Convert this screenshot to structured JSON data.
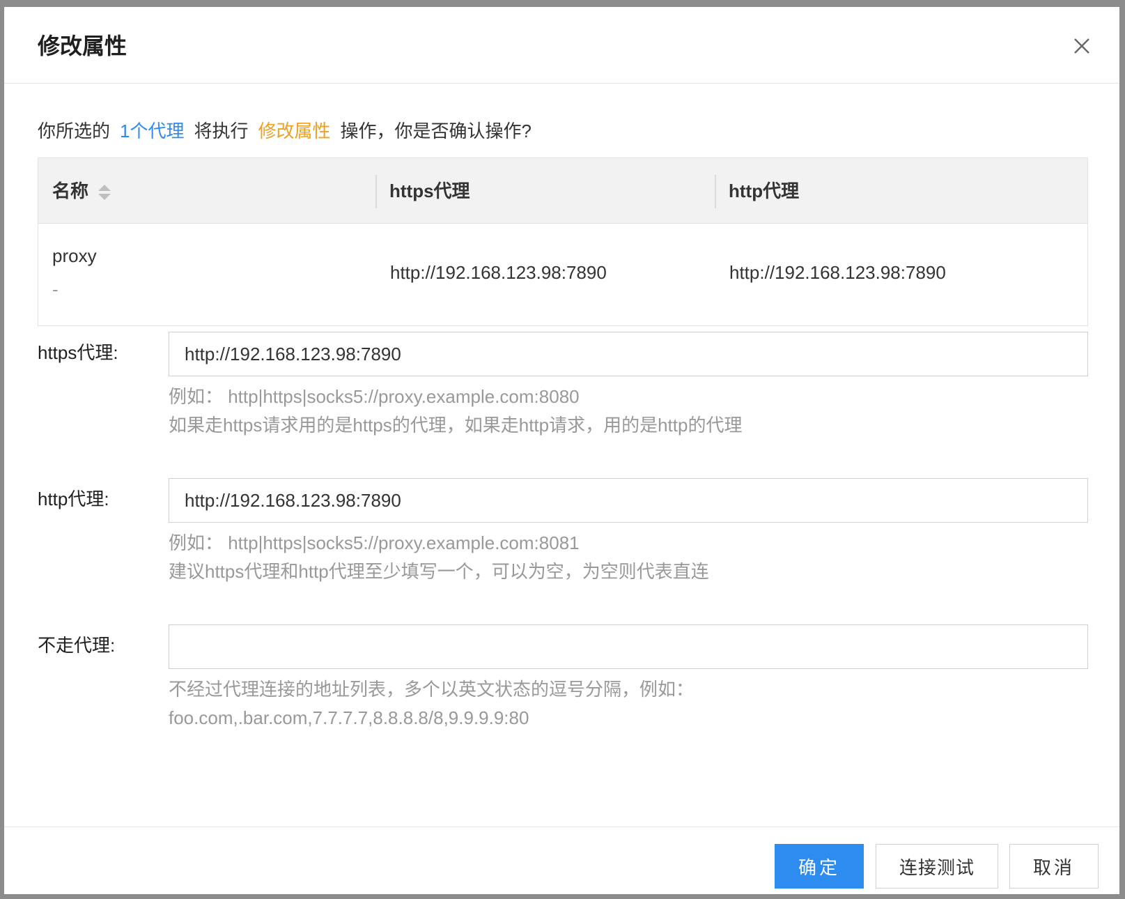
{
  "dialog": {
    "title": "修改属性"
  },
  "confirm": {
    "prefix": "你所选的",
    "count": "1个代理",
    "middle": "将执行",
    "action": "修改属性",
    "suffix": "操作，你是否确认操作?"
  },
  "table": {
    "headers": [
      "名称",
      "https代理",
      "http代理"
    ],
    "rows": [
      {
        "name": "proxy",
        "sub": "-",
        "https": "http://192.168.123.98:7890",
        "http": "http://192.168.123.98:7890"
      }
    ]
  },
  "form": {
    "https": {
      "label": "https代理:",
      "value": "http://192.168.123.98:7890",
      "hint1": "例如：  http|https|socks5://proxy.example.com:8080",
      "hint2": "如果走https请求用的是https的代理，如果走http请求，用的是http的代理"
    },
    "http": {
      "label": "http代理:",
      "value": "http://192.168.123.98:7890",
      "hint1": "例如：  http|https|socks5://proxy.example.com:8081",
      "hint2": "建议https代理和http代理至少填写一个，可以为空，为空则代表直连"
    },
    "noproxy": {
      "label": "不走代理:",
      "value": "",
      "hint1": "不经过代理连接的地址列表，多个以英文状态的逗号分隔，例如：",
      "hint2": "foo.com,.bar.com,7.7.7.7,8.8.8.8/8,9.9.9.9:80"
    }
  },
  "footer": {
    "ok": "确定",
    "test": "连接测试",
    "cancel": "取消"
  },
  "colors": {
    "primary": "#2e8bf0",
    "highlight_orange": "#f0a020"
  },
  "icons": {
    "close": "close-icon",
    "sort": "sort-icon"
  }
}
